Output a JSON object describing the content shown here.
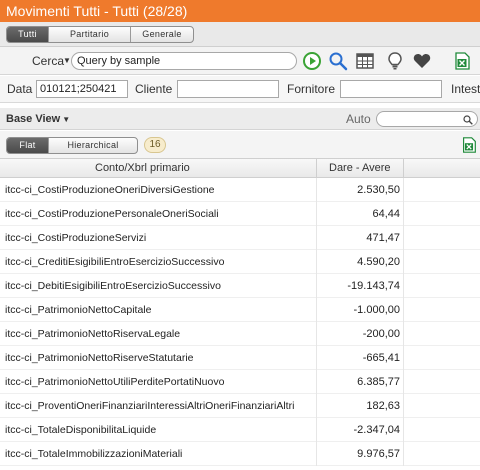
{
  "window": {
    "title": "Movimenti Tutti - Tutti (28/28)"
  },
  "tabs": [
    "Tutti",
    "Partitario",
    "Generale"
  ],
  "toolbar": {
    "search_label": "Cerca",
    "search_value": "Query by sample",
    "icons": [
      "play-icon",
      "magnifier-icon",
      "table-icon",
      "lightbulb-icon",
      "heart-icon",
      "excel-icon"
    ]
  },
  "filters": {
    "data_label": "Data",
    "data_value": "010121;250421",
    "cliente_label": "Cliente",
    "cliente_value": "",
    "fornitore_label": "Fornitore",
    "fornitore_value": "",
    "intest_label": "Intest"
  },
  "view": {
    "label": "Base View",
    "auto_label": "Auto",
    "auto_value": ""
  },
  "modes": [
    "Flat",
    "Hierarchical"
  ],
  "count": "16",
  "grid": {
    "columns": [
      "Conto/Xbrl primario",
      "Dare - Avere"
    ],
    "rows": [
      {
        "account": "itcc-ci_CostiProduzioneOneriDiversiGestione",
        "amount": "2.530,50"
      },
      {
        "account": "itcc-ci_CostiProduzionePersonaleOneriSociali",
        "amount": "64,44"
      },
      {
        "account": "itcc-ci_CostiProduzioneServizi",
        "amount": "471,47"
      },
      {
        "account": "itcc-ci_CreditiEsigibiliEntroEsercizioSuccessivo",
        "amount": "4.590,20"
      },
      {
        "account": "itcc-ci_DebitiEsigibiliEntroEsercizioSuccessivo",
        "amount": "-19.143,74"
      },
      {
        "account": "itcc-ci_PatrimonioNettoCapitale",
        "amount": "-1.000,00"
      },
      {
        "account": "itcc-ci_PatrimonioNettoRiservaLegale",
        "amount": "-200,00"
      },
      {
        "account": "itcc-ci_PatrimonioNettoRiserveStatutarie",
        "amount": "-665,41"
      },
      {
        "account": "itcc-ci_PatrimonioNettoUtiliPerditePortatiNuovo",
        "amount": "6.385,77"
      },
      {
        "account": "itcc-ci_ProventiOneriFinanziariInteressiAltriOneriFinanziariAltri",
        "amount": "182,63"
      },
      {
        "account": "itcc-ci_TotaleDisponibilitaLiquide",
        "amount": "-2.347,04"
      },
      {
        "account": "itcc-ci_TotaleImmobilizzazioniMateriali",
        "amount": "9.976,57"
      }
    ]
  },
  "colors": {
    "titlebar": "#ef7a2c",
    "play": "#3aa335",
    "excel": "#1f8a3a"
  }
}
